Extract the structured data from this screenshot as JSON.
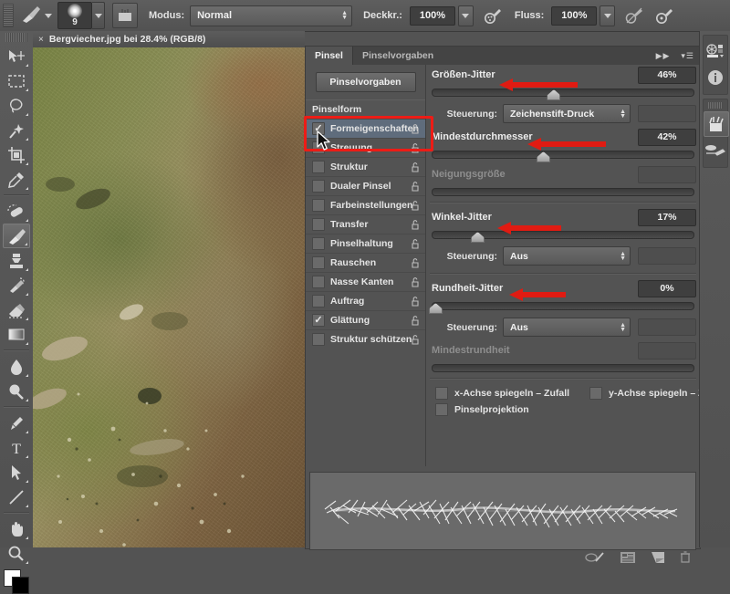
{
  "options_bar": {
    "brush_size": "9",
    "mode_label": "Modus:",
    "mode_value": "Normal",
    "opacity_label": "Deckkr.:",
    "opacity_value": "100%",
    "flow_label": "Fluss:",
    "flow_value": "100%",
    "icons": [
      "brush-tool-icon",
      "brush-preset-chevron-icon",
      "tablet-pressure-icon",
      "airbrush-icon",
      "pressure-opacity-icon",
      "pressure-size-icon"
    ]
  },
  "toolbar": {
    "tools": [
      {
        "name": "move-tool",
        "glyph": "move"
      },
      {
        "name": "rectangular-marquee-tool",
        "glyph": "marquee"
      },
      {
        "name": "lasso-tool",
        "glyph": "lasso"
      },
      {
        "name": "magic-wand-tool",
        "glyph": "wand"
      },
      {
        "name": "crop-tool",
        "glyph": "crop"
      },
      {
        "name": "eyedropper-tool",
        "glyph": "eyedropper"
      },
      {
        "name": "healing-brush-tool",
        "glyph": "healing"
      },
      {
        "name": "brush-tool",
        "glyph": "brush",
        "selected": true
      },
      {
        "name": "clone-stamp-tool",
        "glyph": "stamp"
      },
      {
        "name": "history-brush-tool",
        "glyph": "historybrush"
      },
      {
        "name": "eraser-tool",
        "glyph": "eraser"
      },
      {
        "name": "gradient-tool",
        "glyph": "gradient"
      },
      {
        "name": "blur-tool",
        "glyph": "blur"
      },
      {
        "name": "dodge-tool",
        "glyph": "dodge"
      },
      {
        "name": "pen-tool",
        "glyph": "pen"
      },
      {
        "name": "type-tool",
        "glyph": "T"
      },
      {
        "name": "path-selection-tool",
        "glyph": "arrow"
      },
      {
        "name": "line-tool",
        "glyph": "line"
      },
      {
        "name": "hand-tool",
        "glyph": "hand"
      },
      {
        "name": "zoom-tool",
        "glyph": "zoom"
      }
    ]
  },
  "document": {
    "tab_title": "Bergviecher.jpg bei 28.4% (RGB/8)",
    "close_glyph": "×"
  },
  "panel": {
    "tabs": [
      {
        "label": "Pinsel",
        "active": true
      },
      {
        "label": "Pinselvorgaben",
        "active": false
      }
    ],
    "preset_button": "Pinselvorgaben",
    "left_list": [
      {
        "label": "Pinselform",
        "type": "header",
        "checked": false
      },
      {
        "label": "Formeigenschaften",
        "type": "item",
        "checked": true,
        "selected": true
      },
      {
        "label": "Streuung",
        "type": "item",
        "checked": false
      },
      {
        "label": "Struktur",
        "type": "item",
        "checked": false
      },
      {
        "label": "Dualer Pinsel",
        "type": "item",
        "checked": false
      },
      {
        "label": "Farbeinstellungen",
        "type": "item",
        "checked": false
      },
      {
        "label": "Transfer",
        "type": "item",
        "checked": false
      },
      {
        "label": "Pinselhaltung",
        "type": "item",
        "checked": false
      },
      {
        "label": "Rauschen",
        "type": "item",
        "checked": false
      },
      {
        "label": "Nasse Kanten",
        "type": "item",
        "checked": false
      },
      {
        "label": "Auftrag",
        "type": "item",
        "checked": false
      },
      {
        "label": "Glättung",
        "type": "item",
        "checked": true
      },
      {
        "label": "Struktur schützen",
        "type": "item",
        "checked": false
      }
    ],
    "controls": {
      "size_jitter": {
        "label": "Größen-Jitter",
        "value": "46%",
        "percent": 46
      },
      "size_control": {
        "label": "Steuerung:",
        "value": "Zeichenstift-Druck"
      },
      "min_diameter": {
        "label": "Mindestdurchmesser",
        "value": "42%",
        "percent": 42
      },
      "tilt_scale": {
        "label": "Neigungsgröße",
        "value": "",
        "percent": 0,
        "disabled": true
      },
      "angle_jitter": {
        "label": "Winkel-Jitter",
        "value": "17%",
        "percent": 17
      },
      "angle_control": {
        "label": "Steuerung:",
        "value": "Aus"
      },
      "roundness_jitter": {
        "label": "Rundheit-Jitter",
        "value": "0%",
        "percent": 0
      },
      "roundness_control": {
        "label": "Steuerung:",
        "value": "Aus"
      },
      "min_roundness": {
        "label": "Mindestrundheit",
        "value": "",
        "percent": 0,
        "disabled": true
      }
    },
    "checkboxes": [
      {
        "label": "x-Achse spiegeln – Zufall",
        "checked": false
      },
      {
        "label": "y-Achse spiegeln – Zufall",
        "checked": false
      },
      {
        "label": "Pinselprojektion",
        "checked": false
      }
    ]
  },
  "dock": {
    "icons": [
      "color-swatch-icon",
      "info-icon",
      "brush-panel-icon",
      "brush-presets-icon"
    ]
  },
  "annotations": {
    "highlight_color": "#ed1c16",
    "arrows": [
      "size-jitter-arrow",
      "min-diameter-arrow",
      "angle-jitter-arrow",
      "roundness-jitter-arrow"
    ],
    "boxes": [
      "formeigenschaften-highlight"
    ]
  }
}
